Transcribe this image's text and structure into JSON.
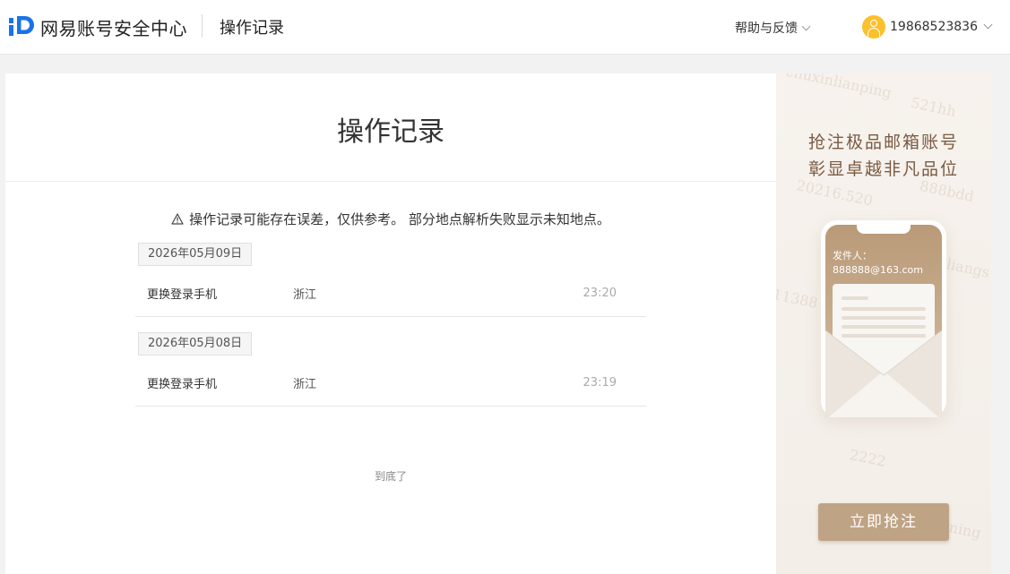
{
  "header": {
    "brand": "网易账号安全中心",
    "page_title": "操作记录",
    "help_label": "帮助与反馈",
    "phone": "19868523836"
  },
  "main": {
    "title": "操作记录",
    "notice": "操作记录可能存在误差，仅供参考。 部分地点解析失败显示未知地点。",
    "records": [
      {
        "date": "2026年05月09日",
        "action": "更换登录手机",
        "location": "浙江",
        "time": "23:20"
      },
      {
        "date": "2026年05月08日",
        "action": "更换登录手机",
        "location": "浙江",
        "time": "23:19"
      }
    ],
    "end_text": "到底了"
  },
  "ad": {
    "line1": "抢注极品邮箱账号",
    "line2": "彰显卓越非凡品位",
    "sender_label": "发件人：",
    "sender_address": "888888@163.com",
    "button_label": "立即抢注",
    "watermarks": [
      "chuxinlianping",
      "521hh",
      "20216.520",
      "888bdd",
      "11388",
      "2222",
      "ming",
      "liangs"
    ]
  },
  "colors": {
    "brand_blue": "#1a73e8",
    "avatar_yellow": "#fbc02d",
    "ad_text": "#7a5b42",
    "ad_button": "#bfa385"
  }
}
